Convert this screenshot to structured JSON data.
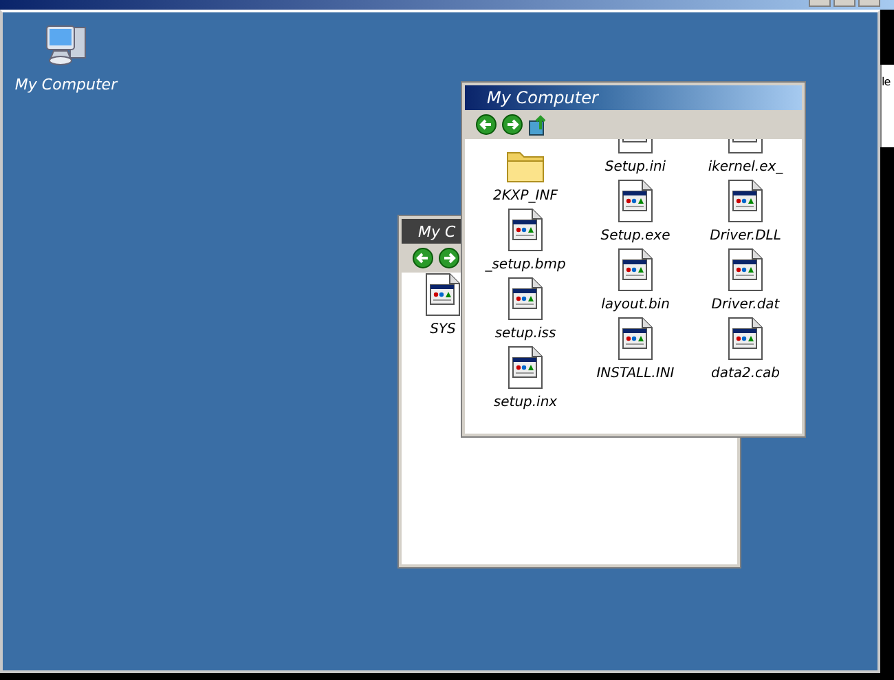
{
  "side_strip": {
    "text": "le"
  },
  "desktop_icons": [
    {
      "label": "My Computer",
      "kind": "computer"
    }
  ],
  "windows": [
    {
      "title": "My C",
      "active": false,
      "columns": [
        [
          {
            "label": "SYS",
            "kind": "file"
          }
        ]
      ]
    },
    {
      "title": "My Computer",
      "active": true,
      "columns": [
        [
          {
            "label": "2KXP_INF",
            "kind": "folder"
          },
          {
            "label": "_setup.bmp",
            "kind": "file"
          },
          {
            "label": "setup.iss",
            "kind": "file"
          },
          {
            "label": "setup.inx",
            "kind": "file"
          }
        ],
        [
          {
            "label": "Setup.ini",
            "kind": "file"
          },
          {
            "label": "Setup.exe",
            "kind": "file"
          },
          {
            "label": "layout.bin",
            "kind": "file"
          },
          {
            "label": "INSTALL.INI",
            "kind": "file"
          }
        ],
        [
          {
            "label": "ikernel.ex_",
            "kind": "file"
          },
          {
            "label": "Driver.DLL",
            "kind": "file"
          },
          {
            "label": "Driver.dat",
            "kind": "file"
          },
          {
            "label": "data2.cab",
            "kind": "file"
          }
        ]
      ]
    }
  ]
}
